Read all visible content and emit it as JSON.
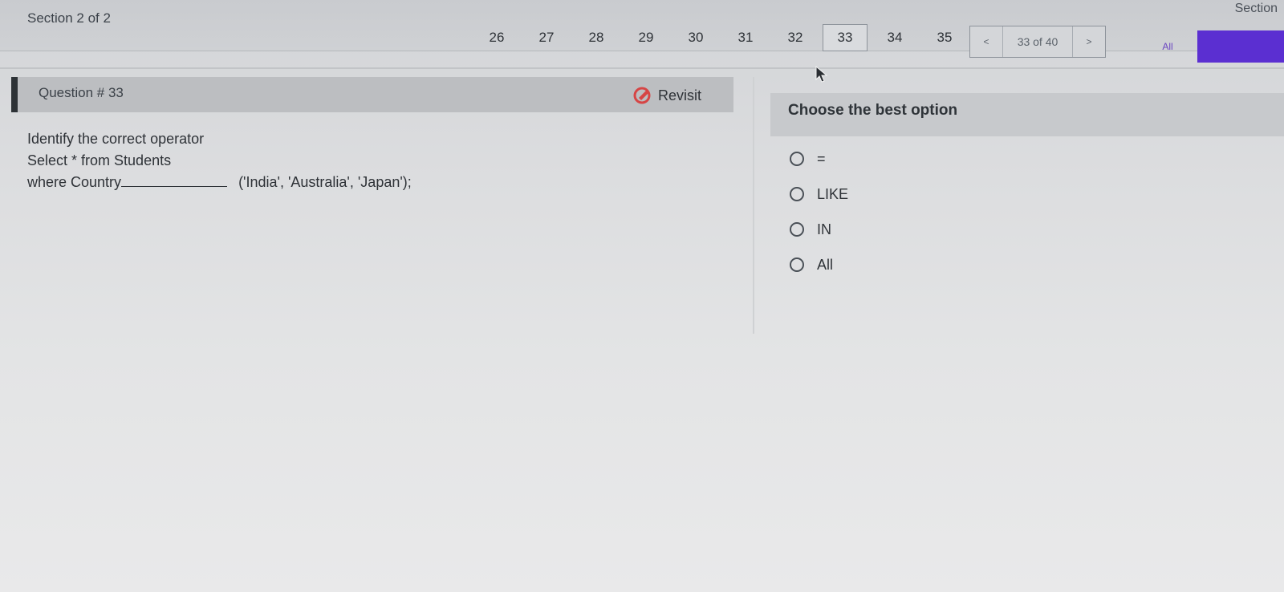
{
  "header": {
    "section_label": "Section 2 of 2",
    "section_right": "Section"
  },
  "question_nav": {
    "numbers": [
      "26",
      "27",
      "28",
      "29",
      "30",
      "31",
      "32",
      "33",
      "34",
      "35"
    ],
    "current": "33"
  },
  "pager": {
    "prev": "<",
    "status": "33 of 40",
    "next": ">"
  },
  "filter": {
    "all_label": "All"
  },
  "question": {
    "title": "Question # 33",
    "revisit_label": "Revisit",
    "line1": "Identify the correct operator",
    "line2": "Select * from Students",
    "line3_prefix": "where Country",
    "line3_suffix": "('India', 'Australia', 'Japan');"
  },
  "answers": {
    "heading": "Choose the best option",
    "options": [
      "=",
      "LIKE",
      "IN",
      "All"
    ]
  },
  "colors": {
    "accent": "#5b2fd1",
    "revisit_icon": "#d64545"
  }
}
